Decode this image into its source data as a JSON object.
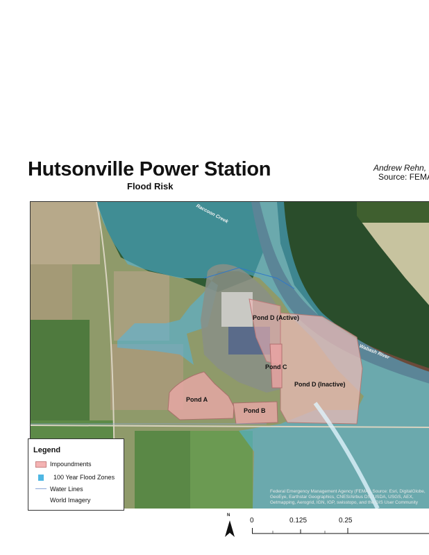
{
  "header": {
    "title": "Hutsonville Power Station",
    "subtitle": "Flood Risk",
    "author": "Andrew Rehn, I",
    "source": "Source: FEMA"
  },
  "map": {
    "labels": {
      "pond_d_active": "Pond D (Active)",
      "pond_c": "Pond C",
      "pond_d_inactive": "Pond D (Inactive)",
      "pond_a": "Pond A",
      "pond_b": "Pond B"
    },
    "rivers": {
      "raccoon_creek": "Raccoon Creek",
      "wabash_river": "Wabash River"
    },
    "credit": "Federal Emergency Management Agency (FEMA), Source: Esri, DigitalGlobe, GeoEye, Earthstar Geographics, CNES/Airbus DS, USDA, USGS, AEX, Getmapping, Aerogrid, IGN, IGP, swisstopo, and the GIS User Community",
    "colors": {
      "impoundment": "#f4b3b3",
      "flood_zone": "#4fb7e3",
      "water_line": "#8aa6d6",
      "river": "#6b4a3a"
    }
  },
  "legend": {
    "title": "Legend",
    "items": {
      "impoundments": "Impoundments",
      "flood": "100 Year Flood Zones",
      "water": "Water Lines",
      "imagery": "World Imagery"
    }
  },
  "scale_bar": {
    "north": "N",
    "ticks": [
      "0",
      "0.125",
      "0.25"
    ]
  }
}
